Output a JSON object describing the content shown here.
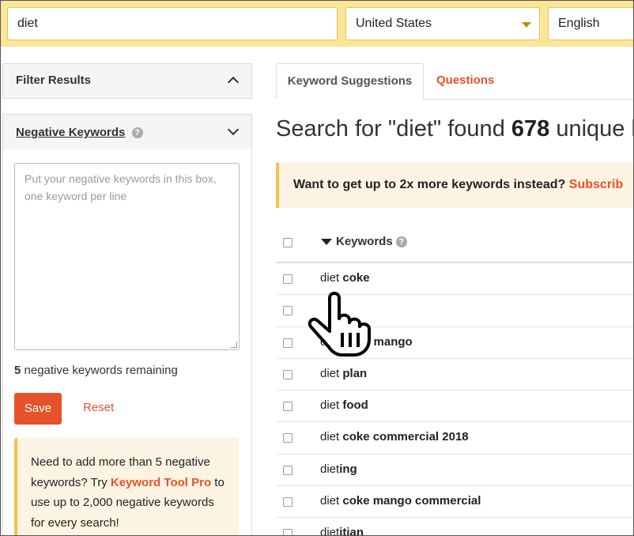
{
  "search": {
    "keyword_value": "diet",
    "country_value": "United States",
    "language_value": "English"
  },
  "sidebar": {
    "filter_title": "Filter Results",
    "negative_title": "Negative Keywords",
    "negative_placeholder": "Put your negative keywords in this box, one keyword per line",
    "remaining_count": "5",
    "remaining_text": "negative keywords remaining",
    "save_label": "Save",
    "reset_label": "Reset",
    "promo": {
      "text_before": "Need to add more than 5 negative keywords? Try ",
      "link": "Keyword Tool Pro",
      "text_after": " to use up to 2,000 negative keywords for every search!"
    }
  },
  "tabs": {
    "suggestions": "Keyword Suggestions",
    "questions": "Questions"
  },
  "results": {
    "headline_before": "Search for \"diet\" found ",
    "count": "678",
    "headline_after": " unique k",
    "banner_text": "Want to get up to 2x more keywords instead? ",
    "banner_cta": "Subscrib"
  },
  "table": {
    "header": "Keywords",
    "rows": [
      {
        "base": "diet ",
        "bold": "coke"
      },
      {
        "base": "",
        "bold": ""
      },
      {
        "base": "di",
        "bold": "et coke mango"
      },
      {
        "base": "diet ",
        "bold": "plan"
      },
      {
        "base": "diet ",
        "bold": "food"
      },
      {
        "base": "diet ",
        "bold": "coke commercial 2018"
      },
      {
        "base": "diet",
        "bold": "ing"
      },
      {
        "base": "diet ",
        "bold": "coke mango commercial"
      },
      {
        "base": "diet",
        "bold": "itian"
      }
    ]
  },
  "colors": {
    "accent": "#e8522a",
    "topbar": "#fbe599",
    "promo_bg": "#fdf3e2"
  }
}
